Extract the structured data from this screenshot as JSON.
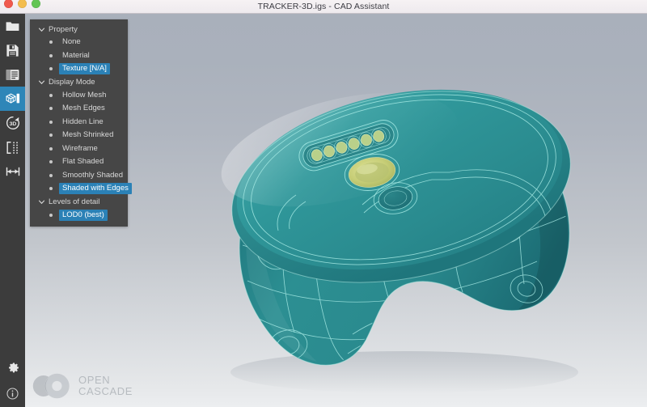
{
  "window": {
    "title": "TRACKER-3D.igs - CAD Assistant",
    "traffic_lights": [
      {
        "name": "close",
        "color": "#f0594d"
      },
      {
        "name": "minimize",
        "color": "#f3bd4e"
      },
      {
        "name": "zoom",
        "color": "#62c554"
      }
    ]
  },
  "toolbar": {
    "items": [
      {
        "id": "open-file",
        "icon": "folder-icon",
        "label": "Open",
        "selected": false
      },
      {
        "id": "save-file",
        "icon": "floppy-disk-icon",
        "label": "Save",
        "selected": false
      },
      {
        "id": "structure",
        "icon": "list-panel-icon",
        "label": "Structure",
        "selected": false
      },
      {
        "id": "display-props",
        "icon": "mesh-panel-icon",
        "label": "Properties",
        "selected": true
      },
      {
        "id": "view-3d",
        "icon": "rotate-3d-icon",
        "label": "3D View",
        "selected": false
      },
      {
        "id": "clip-plane",
        "icon": "clip-plane-icon",
        "label": "Clipping",
        "selected": false
      },
      {
        "id": "measure",
        "icon": "measure-icon",
        "label": "Measure",
        "selected": false
      }
    ],
    "bottom_items": [
      {
        "id": "settings",
        "icon": "gear-icon",
        "label": "Settings"
      },
      {
        "id": "about",
        "icon": "info-icon",
        "label": "About"
      }
    ]
  },
  "tree": {
    "groups": [
      {
        "label": "Property",
        "expanded": true,
        "items": [
          {
            "label": "None",
            "active": false
          },
          {
            "label": "Material",
            "active": false
          },
          {
            "label": "Texture [N/A]",
            "active": true
          }
        ]
      },
      {
        "label": "Display Mode",
        "expanded": true,
        "items": [
          {
            "label": "Hollow Mesh",
            "active": false
          },
          {
            "label": "Mesh Edges",
            "active": false
          },
          {
            "label": "Hidden Line",
            "active": false
          },
          {
            "label": "Mesh Shrinked",
            "active": false
          },
          {
            "label": "Wireframe",
            "active": false
          },
          {
            "label": "Flat Shaded",
            "active": false
          },
          {
            "label": "Smoothly Shaded",
            "active": false
          },
          {
            "label": "Shaded with Edges",
            "active": true
          }
        ]
      },
      {
        "label": "Levels of detail",
        "expanded": true,
        "items": [
          {
            "label": "LOD0 (best)",
            "active": true
          }
        ]
      }
    ]
  },
  "logo": {
    "line1": "OPEN",
    "line2": "CASCADE",
    "mark": "infinity-rings-icon"
  },
  "colors": {
    "accent": "#2b81b6",
    "panel_bg": "#464646",
    "toolbar_bg": "#3c3c3c",
    "model_teal": "#2e8f92",
    "model_edge": "#9fe4e0",
    "button_yellow": "#c3cc72"
  },
  "viewport": {
    "model_name": "TRACKER-3D",
    "display_mode": "Shaded with Edges"
  }
}
